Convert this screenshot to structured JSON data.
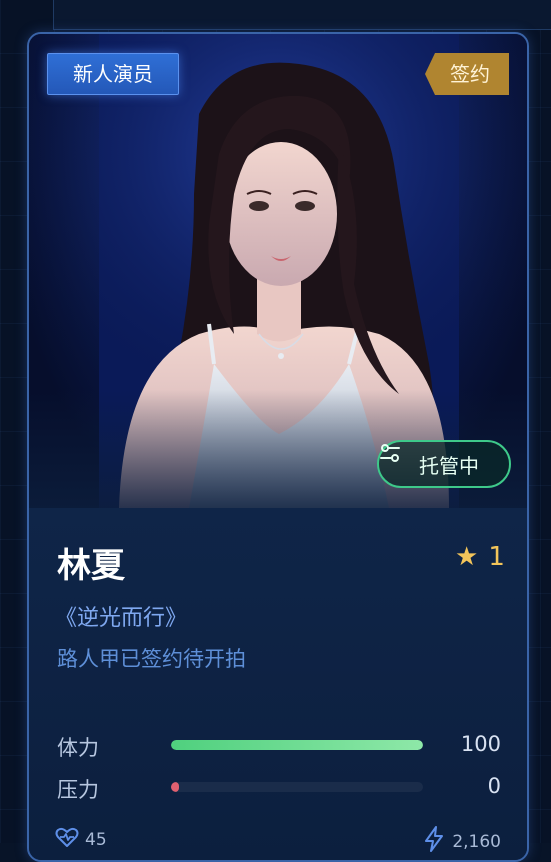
{
  "card": {
    "tag_new": "新人演员",
    "tag_contract": "签约",
    "managed_label": "托管中",
    "name": "林夏",
    "star_count": "1",
    "project": "《逆光而行》",
    "status": "路人甲已签约待开拍",
    "stats": [
      {
        "label": "体力",
        "value": "100",
        "fraction": 1.0,
        "color": "#4fd07e"
      },
      {
        "label": "压力",
        "value": "0",
        "fraction": 0.0,
        "color": "#e06070"
      }
    ],
    "likes": "45",
    "energy": "2,160"
  },
  "colors": {
    "accent_blue": "#2f6fd6",
    "contract_gold": "#b08530",
    "managed_green": "#3ec98a",
    "star_yellow": "#f3c55a"
  },
  "icons": {
    "managed": "sliders-icon",
    "star": "star-icon",
    "likes": "heart-pulse-icon",
    "energy": "lightning-icon"
  }
}
